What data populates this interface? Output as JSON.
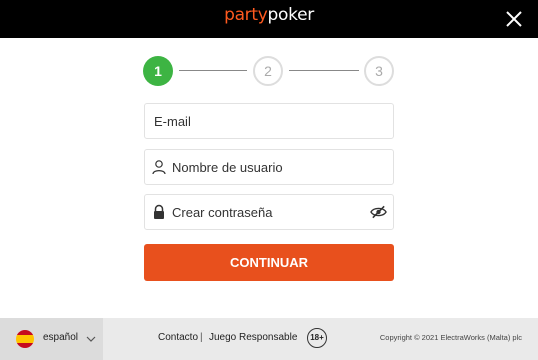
{
  "header": {
    "logo_left": "party",
    "logo_o": "o",
    "logo_right": "ker",
    "close_icon": "close-icon"
  },
  "steps": [
    "1",
    "2",
    "3"
  ],
  "form": {
    "email_label": "E-mail",
    "username_label": "Nombre de usuario",
    "password_label": "Crear contraseña",
    "continue_label": "CONTINUAR"
  },
  "footer": {
    "language": "español",
    "contact": "Contacto",
    "separator": "|",
    "responsible": "Juego Responsable",
    "age_badge": "18+",
    "copyright": "Copyright © 2021 ElectraWorks (Malta) plc"
  },
  "colors": {
    "brand_orange": "#e8501d",
    "step_active": "#3db443"
  }
}
